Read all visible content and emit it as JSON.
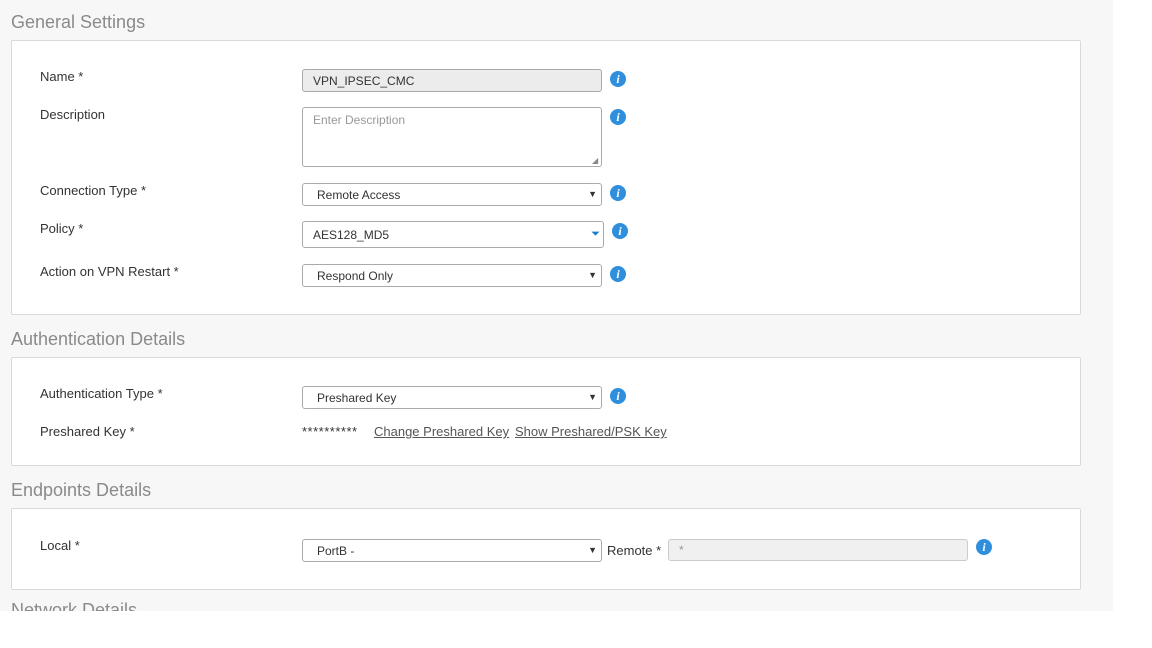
{
  "general": {
    "title": "General Settings",
    "name_label": "Name *",
    "name_value": "VPN_IPSEC_CMC",
    "description_label": "Description",
    "description_placeholder": "Enter Description",
    "connection_type_label": "Connection Type *",
    "connection_type_value": "Remote Access",
    "policy_label": "Policy *",
    "policy_value": "AES128_MD5",
    "action_label": "Action on VPN Restart *",
    "action_value": "Respond Only"
  },
  "auth": {
    "title": "Authentication Details",
    "type_label": "Authentication Type *",
    "type_value": "Preshared Key",
    "key_label": "Preshared Key *",
    "key_mask": "**********",
    "change_link": "Change Preshared Key",
    "show_link": "Show Preshared/PSK Key"
  },
  "endpoints": {
    "title": "Endpoints Details",
    "local_label": "Local *",
    "local_value": "PortB -",
    "remote_label": "Remote *",
    "remote_placeholder": "*"
  },
  "network": {
    "title": "Network Details"
  },
  "icons": {
    "info": "info-icon",
    "dropdown": "chevron-down-icon"
  },
  "colors": {
    "info_icon": "#2f8fdd",
    "section_title": "#8a8a8a",
    "page_bg": "#f7f7f7"
  }
}
